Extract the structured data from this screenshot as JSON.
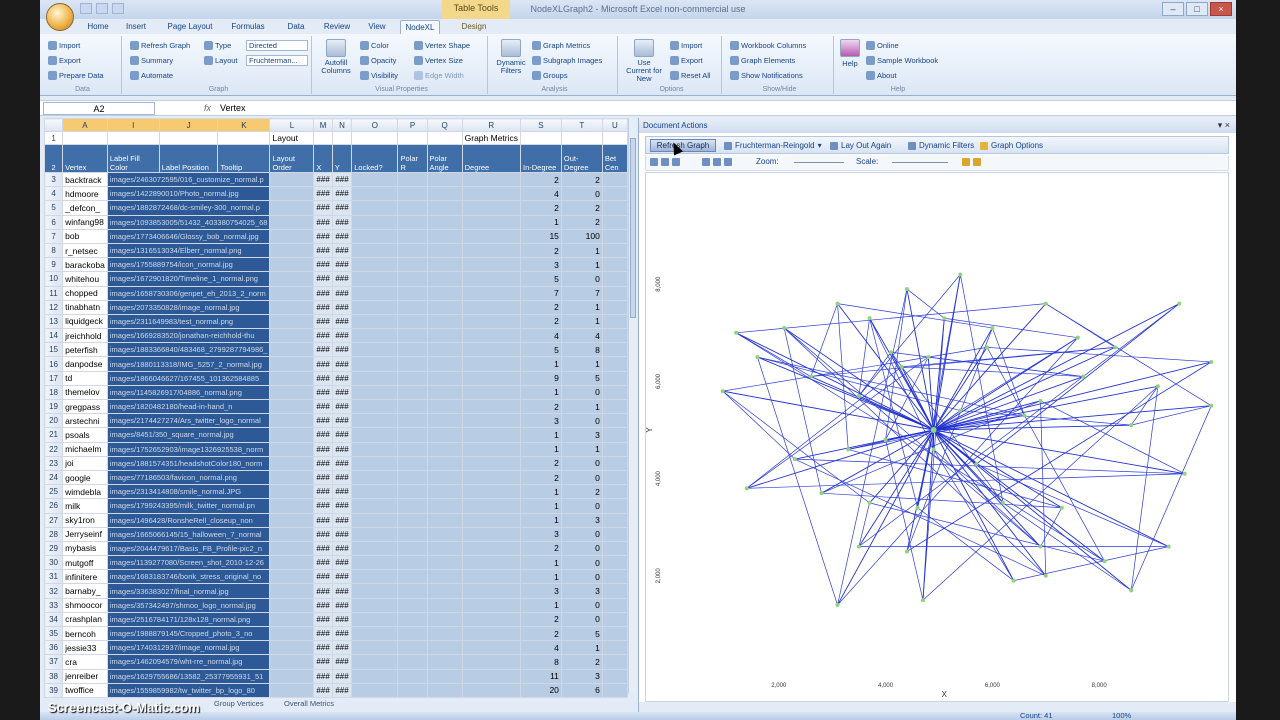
{
  "window": {
    "title": "NodeXLGraph2 - Microsoft Excel non-commercial use",
    "context_tab": "Table Tools"
  },
  "tabs": [
    "Home",
    "Insert",
    "Page Layout",
    "Formulas",
    "Data",
    "Review",
    "View",
    "NodeXL",
    "Design"
  ],
  "active_tab": "NodeXL",
  "ribbon": {
    "data_group": {
      "import": "Import",
      "export": "Export",
      "prepare": "Prepare Data",
      "label": "Data"
    },
    "graph_group": {
      "refresh": "Refresh Graph",
      "summary": "Summary",
      "automate": "Automate",
      "type_label": "Type",
      "type_value": "Directed",
      "layout_label": "Layout",
      "layout_value": "Fruchterman...",
      "label": "Graph"
    },
    "visual_group": {
      "autofill": "Autofill Columns",
      "color": "Color",
      "opacity": "Opacity",
      "visibility": "Visibility",
      "vertex_shape": "Vertex Shape",
      "vertex_size": "Vertex Size",
      "edge_width": "Edge Width",
      "label": "Visual Properties"
    },
    "analysis_group": {
      "dynamic_filters": "Dynamic Filters",
      "graph_metrics": "Graph Metrics",
      "subgraph_images": "Subgraph Images",
      "groups": "Groups",
      "label": "Analysis"
    },
    "options_group": {
      "use_current": "Use Current for New",
      "import": "Import",
      "export": "Export",
      "reset_all": "Reset All",
      "label": "Options"
    },
    "showhide_group": {
      "workbook_columns": "Workbook Columns",
      "graph_elements": "Graph Elements",
      "show_notifications": "Show Notifications",
      "label": "Show/Hide"
    },
    "help_group": {
      "help": "Help",
      "online": "Online",
      "sample": "Sample Workbook",
      "about": "About",
      "label": "Help"
    }
  },
  "formula_bar": {
    "cell": "A2",
    "fx": "fx",
    "value": "Vertex"
  },
  "sheet": {
    "col_letters": [
      "A",
      "I",
      "J",
      "K",
      "L",
      "M",
      "N",
      "O",
      "P",
      "Q",
      "R",
      "S",
      "T",
      "U"
    ],
    "group_layout": "Layout",
    "group_metrics": "Graph Metrics",
    "headers": [
      "Vertex",
      "Label Fill Color",
      "Label Position",
      "Tooltip",
      "Layout Order",
      "X",
      "Y",
      "Locked?",
      "Polar R",
      "Polar Angle",
      "Degree",
      "In-Degree",
      "Out-Degree",
      "Bet Cen"
    ],
    "rows": [
      {
        "n": "3",
        "vertex": "backtrack",
        "img": "images/2463072595/016_customize_normal.p",
        "ind": "2",
        "outd": "2"
      },
      {
        "n": "4",
        "vertex": "hdmoore",
        "img": "images/1422890010/Photo_normal.jpg",
        "ind": "4",
        "outd": "0"
      },
      {
        "n": "5",
        "vertex": "_defcon_",
        "img": "images/1882872468/dc-smiley-300_normal.p",
        "ind": "2",
        "outd": "2"
      },
      {
        "n": "6",
        "vertex": "winfang98",
        "img": "images/1093853005/51432_403380754025_68",
        "ind": "1",
        "outd": "2"
      },
      {
        "n": "7",
        "vertex": "bob",
        "img": "images/1773406646/Glossy_bob_normal.jpg",
        "ind": "15",
        "outd": "100"
      },
      {
        "n": "8",
        "vertex": "r_netsec",
        "img": "images/1316513034/Elberr_normal.png",
        "ind": "2",
        "outd": "1"
      },
      {
        "n": "9",
        "vertex": "barackoba",
        "img": "images/1755889754/icon_normal.jpg",
        "ind": "3",
        "outd": "1"
      },
      {
        "n": "10",
        "vertex": "whitehou",
        "img": "images/1672901820/Timeline_1_normal.png",
        "ind": "5",
        "outd": "0"
      },
      {
        "n": "11",
        "vertex": "chopped",
        "img": "images/1658730306/genpet_eh_2013_2_norm",
        "ind": "7",
        "outd": "7"
      },
      {
        "n": "12",
        "vertex": "tinabhatn",
        "img": "images/2073350828/image_normal.jpg",
        "ind": "2",
        "outd": "1"
      },
      {
        "n": "13",
        "vertex": "liquidgeck",
        "img": "images/2311649983/test_normal.png",
        "ind": "2",
        "outd": "1"
      },
      {
        "n": "14",
        "vertex": "jreichhold",
        "img": "images/1669283520/jonathan-reichhold-thu",
        "ind": "4",
        "outd": "4"
      },
      {
        "n": "15",
        "vertex": "peterfish",
        "img": "images/1883366840/483468_2799287794986_",
        "ind": "5",
        "outd": "8"
      },
      {
        "n": "16",
        "vertex": "danpodse",
        "img": "images/1880113318/IMG_5257_2_normal.jpg",
        "ind": "1",
        "outd": "1"
      },
      {
        "n": "17",
        "vertex": "td",
        "img": "images/1866046627/167455_101362584885",
        "ind": "9",
        "outd": "5"
      },
      {
        "n": "18",
        "vertex": "themelov",
        "img": "images/1145826917/04886_normal.png",
        "ind": "1",
        "outd": "0"
      },
      {
        "n": "19",
        "vertex": "gregpass",
        "img": "images/1820482180/head-in-hand_n",
        "ind": "2",
        "outd": "1"
      },
      {
        "n": "20",
        "vertex": "arstechni",
        "img": "images/2174427274/Ars_twitter_logo_normal",
        "ind": "3",
        "outd": "0"
      },
      {
        "n": "21",
        "vertex": "psoals",
        "img": "images/8451/350_square_normal.jpg",
        "ind": "1",
        "outd": "3"
      },
      {
        "n": "22",
        "vertex": "michaelm",
        "img": "images/1752652903/image1326925538_norm",
        "ind": "1",
        "outd": "1"
      },
      {
        "n": "23",
        "vertex": "joi",
        "img": "images/1881574351/headshotColor180_norm",
        "ind": "2",
        "outd": "0"
      },
      {
        "n": "24",
        "vertex": "google",
        "img": "images/77186503/favicon_normal.png",
        "ind": "2",
        "outd": "0"
      },
      {
        "n": "25",
        "vertex": "wimdebla",
        "img": "images/2313414808/smile_normal.JPG",
        "ind": "1",
        "outd": "2"
      },
      {
        "n": "26",
        "vertex": "milk",
        "img": "images/1799243395/milk_twitter_normal.pn",
        "ind": "1",
        "outd": "0"
      },
      {
        "n": "27",
        "vertex": "sky1ron",
        "img": "images/1496428/RonsheRell_closeup_non",
        "ind": "1",
        "outd": "3"
      },
      {
        "n": "28",
        "vertex": "Jerryseinf",
        "img": "images/1665066145/15_halloween_7_normal",
        "ind": "3",
        "outd": "0"
      },
      {
        "n": "29",
        "vertex": "mybasis",
        "img": "images/2044479617/Basis_FB_Profile-pic2_n",
        "ind": "2",
        "outd": "0"
      },
      {
        "n": "30",
        "vertex": "mutgoff",
        "img": "images/1139277080/Screen_shot_2010-12-26",
        "ind": "1",
        "outd": "0"
      },
      {
        "n": "31",
        "vertex": "infinitere",
        "img": "images/1683183746/bonk_stress_original_no",
        "ind": "1",
        "outd": "0"
      },
      {
        "n": "32",
        "vertex": "barnaby_",
        "img": "images/336383027/final_normal.jpg",
        "ind": "3",
        "outd": "3"
      },
      {
        "n": "33",
        "vertex": "shmoocor",
        "img": "images/357342497/shmoo_logo_normal.jpg",
        "ind": "1",
        "outd": "0"
      },
      {
        "n": "34",
        "vertex": "crashplan",
        "img": "images/2516784171/128x128_normal.png",
        "ind": "2",
        "outd": "0"
      },
      {
        "n": "35",
        "vertex": "berncoh",
        "img": "images/1988879145/Cropped_photo_3_no",
        "ind": "2",
        "outd": "5"
      },
      {
        "n": "36",
        "vertex": "jessie33",
        "img": "images/1740312937/image_normal.jpg",
        "ind": "4",
        "outd": "1"
      },
      {
        "n": "37",
        "vertex": "cra",
        "img": "images/1462094579/wht-rre_normal.jpg",
        "ind": "8",
        "outd": "2"
      },
      {
        "n": "38",
        "vertex": "jenreiber",
        "img": "images/1629755686/13582_25377955931_51",
        "ind": "11",
        "outd": "3"
      },
      {
        "n": "39",
        "vertex": "twoffice",
        "img": "images/1559859982/tw_twitter_bp_logo_80",
        "ind": "20",
        "outd": "6"
      }
    ],
    "sheet_tabs": [
      "Group Vertices",
      "Overall Metrics"
    ]
  },
  "doc_pane": {
    "title": "Document Actions",
    "refresh_graph": "Refresh Graph",
    "layout": "Fruchterman-Reingold",
    "lay_out_again": "Lay Out Again",
    "dynamic_filters": "Dynamic Filters",
    "graph_options": "Graph Options",
    "zoom": "Zoom:",
    "scale": "Scale:"
  },
  "chart_data": {
    "type": "scatter",
    "title": "",
    "xlabel": "X",
    "ylabel": "Y",
    "xticks": [
      "2,000",
      "4,000",
      "6,000",
      "8,000"
    ],
    "yticks": [
      "2,000",
      "4,000",
      "6,000",
      "8,000"
    ],
    "note": "Fruchterman-Reingold directed graph layout; node positions estimated in layout units",
    "hub": [
      4900,
      5000
    ],
    "nodes": [
      [
        950,
        5800
      ],
      [
        1400,
        3800
      ],
      [
        1600,
        6500
      ],
      [
        2100,
        7100
      ],
      [
        2600,
        6100
      ],
      [
        2300,
        4400
      ],
      [
        2800,
        3700
      ],
      [
        3100,
        7600
      ],
      [
        3700,
        7300
      ],
      [
        3500,
        5700
      ],
      [
        3300,
        4600
      ],
      [
        3700,
        3500
      ],
      [
        3500,
        2600
      ],
      [
        3100,
        1400
      ],
      [
        4100,
        6600
      ],
      [
        4000,
        4800
      ],
      [
        4400,
        7900
      ],
      [
        4600,
        3400
      ],
      [
        4300,
        6300
      ],
      [
        4400,
        2500
      ],
      [
        4800,
        6500
      ],
      [
        4900,
        4600
      ],
      [
        4700,
        1500
      ],
      [
        5100,
        7300
      ],
      [
        5400,
        8200
      ],
      [
        5400,
        5400
      ],
      [
        5700,
        4300
      ],
      [
        5900,
        6700
      ],
      [
        6000,
        7100
      ],
      [
        6200,
        3500
      ],
      [
        6400,
        1900
      ],
      [
        6600,
        5300
      ],
      [
        6900,
        2600
      ],
      [
        6900,
        5600
      ],
      [
        7000,
        7600
      ],
      [
        7300,
        3400
      ],
      [
        7600,
        6900
      ],
      [
        7700,
        6100
      ],
      [
        8100,
        2300
      ],
      [
        8300,
        6700
      ],
      [
        8600,
        5100
      ],
      [
        9100,
        5900
      ],
      [
        9600,
        4100
      ],
      [
        9500,
        7600
      ],
      [
        10100,
        6400
      ],
      [
        9300,
        2600
      ],
      [
        7000,
        2000
      ],
      [
        10100,
        5500
      ],
      [
        8600,
        1700
      ],
      [
        1200,
        7000
      ]
    ]
  },
  "status": {
    "count": "Count: 41",
    "zoom": "100%"
  },
  "watermark": "Screencast-O-Matic.com"
}
